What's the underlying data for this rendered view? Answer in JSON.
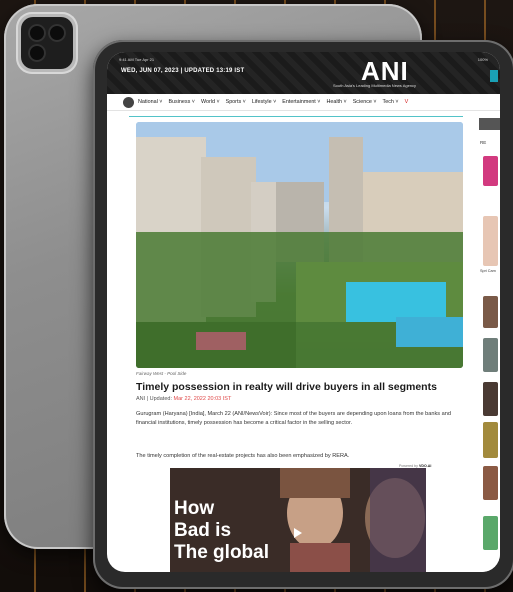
{
  "status_bar": {
    "time": "9:41 AM  Tue Apr 21",
    "battery": "100%"
  },
  "header": {
    "dateline": "WED, JUN 07, 2023 | UPDATED 13:19 IST",
    "logo": "ANI",
    "tagline": "South Asia's Leading Multimedia News Agency"
  },
  "nav": {
    "items": [
      "National ˅",
      "Business ˅",
      "World ˅",
      "Sports ˅",
      "Lifestyle ˅",
      "Entertainment ˅",
      "Health ˅",
      "Science ˅",
      "Tech ˅",
      "V"
    ]
  },
  "article": {
    "caption": "Fairway West - Pool Side",
    "headline": "Timely possession in realty will drive buyers in all segments",
    "byline_prefix": "ANI | Updated:",
    "byline_date": "Mar 22, 2022 20:03 IST",
    "paragraph1": "Gurugram (Haryana) [India], March 22 (ANI/NewsVoir): Since most of the buyers are depending upon loans from the banks and financial institutions, timely possession has become a critical factor in the selling sector.",
    "paragraph2": "The timely completion of the real-estate projects has also been emphasized by RERA."
  },
  "video": {
    "powered_by": "Powered by",
    "vendor": "VDO.AI",
    "text_lines": [
      "How",
      "Bad is",
      "The global"
    ]
  },
  "sidebar": {
    "label": "RE",
    "snippet": "Spri Cam"
  }
}
